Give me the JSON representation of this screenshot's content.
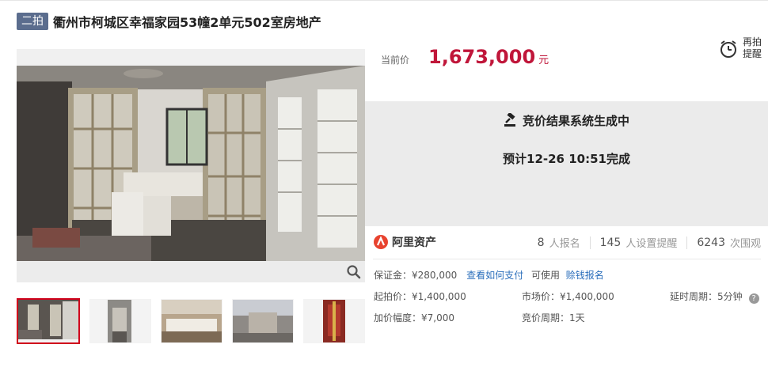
{
  "header": {
    "round_badge": "二拍",
    "title": "衢州市柯城区幸福家园53幢2单元502室房地产"
  },
  "price": {
    "label": "当前价",
    "value": "1,673,000",
    "unit": "元"
  },
  "reminder": {
    "label_line1": "再拍",
    "label_line2": "提醒",
    "icon": "alarm-clock-icon"
  },
  "result": {
    "title": "竞价结果系统生成中",
    "subtitle": "预计12-26 10:51完成",
    "icon": "gavel-icon"
  },
  "platform": {
    "logo_text": "阿里资产"
  },
  "stats": [
    {
      "num": "8",
      "label": "人报名"
    },
    {
      "num": "145",
      "label": "人设置提醒"
    },
    {
      "num": "6243",
      "label": "次围观"
    }
  ],
  "deposit": {
    "label": "保证金：¥280,000",
    "link_how_pay": "查看如何支付",
    "can_use": "可使用",
    "link_credit": "赊钱报名"
  },
  "details": {
    "start_price": "起拍价：¥1,400,000",
    "market_price": "市场价：¥1,400,000",
    "delay_period": "延时周期：5分钟",
    "increment": "加价幅度：¥7,000",
    "bid_period": "竞价周期：1天"
  },
  "colors": {
    "price_red": "#c0163a",
    "badge_blue": "#5b6d8e",
    "link_blue": "#2a6ebb",
    "thumb_active_border": "#d0021b"
  }
}
